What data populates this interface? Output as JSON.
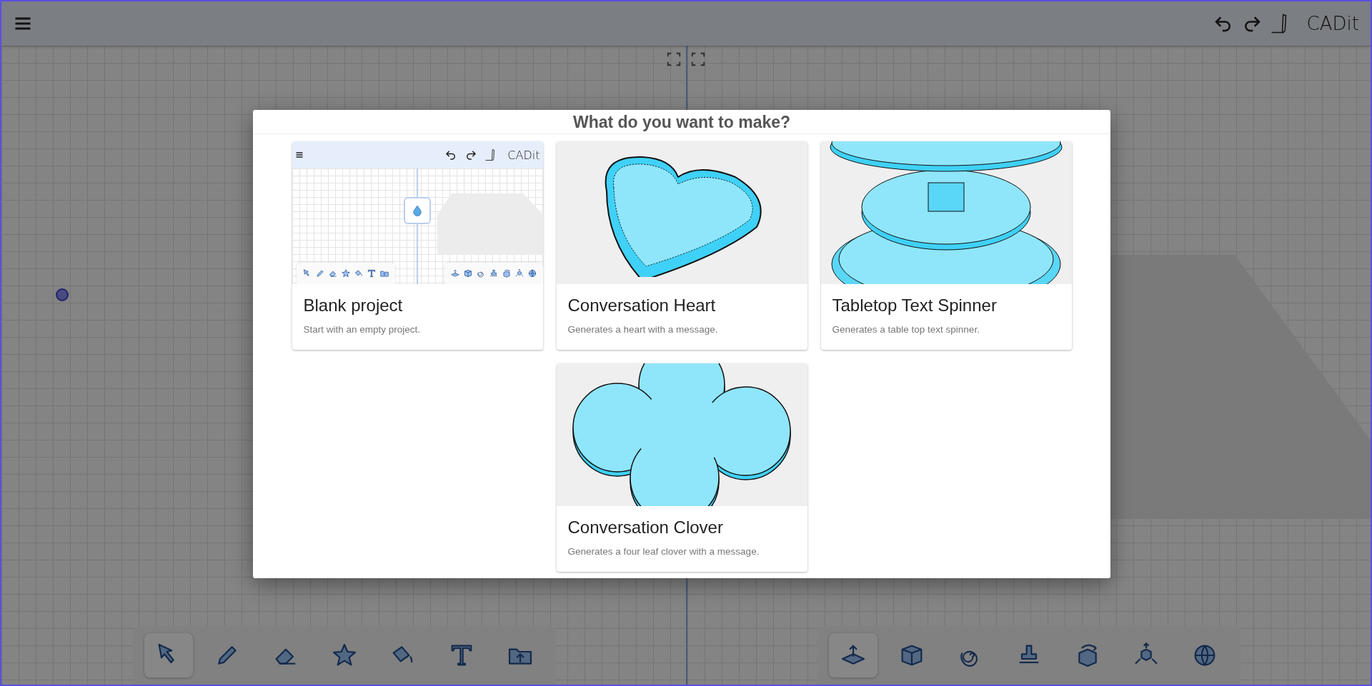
{
  "app_bar": {
    "title": "CADit"
  },
  "left_toolbar": [
    {
      "kind": "select",
      "selected": true
    },
    {
      "kind": "pencil",
      "selected": false
    },
    {
      "kind": "eraser",
      "selected": false
    },
    {
      "kind": "star",
      "selected": false
    },
    {
      "kind": "bucket",
      "selected": false
    },
    {
      "kind": "text",
      "selected": false
    },
    {
      "kind": "folder",
      "selected": false
    }
  ],
  "right_toolbar": [
    {
      "kind": "extrude",
      "selected": true
    },
    {
      "kind": "box",
      "selected": false
    },
    {
      "kind": "spiral",
      "selected": false
    },
    {
      "kind": "stamp",
      "selected": false
    },
    {
      "kind": "rotate",
      "selected": false
    },
    {
      "kind": "explode",
      "selected": false
    },
    {
      "kind": "sphere",
      "selected": false
    }
  ],
  "dialog": {
    "title": "What do you want to make?",
    "cards": [
      {
        "kind": "blank",
        "title": "Blank project",
        "description": "Start with an empty project.",
        "preview_title": "CADit"
      },
      {
        "kind": "heart",
        "title": "Conversation Heart",
        "description": "Generates a heart with a message."
      },
      {
        "kind": "spinner",
        "title": "Tabletop Text Spinner",
        "description": "Generates a table top text spinner."
      },
      {
        "kind": "clover",
        "title": "Conversation Clover",
        "description": "Generates a four leaf clover with a message."
      }
    ]
  }
}
